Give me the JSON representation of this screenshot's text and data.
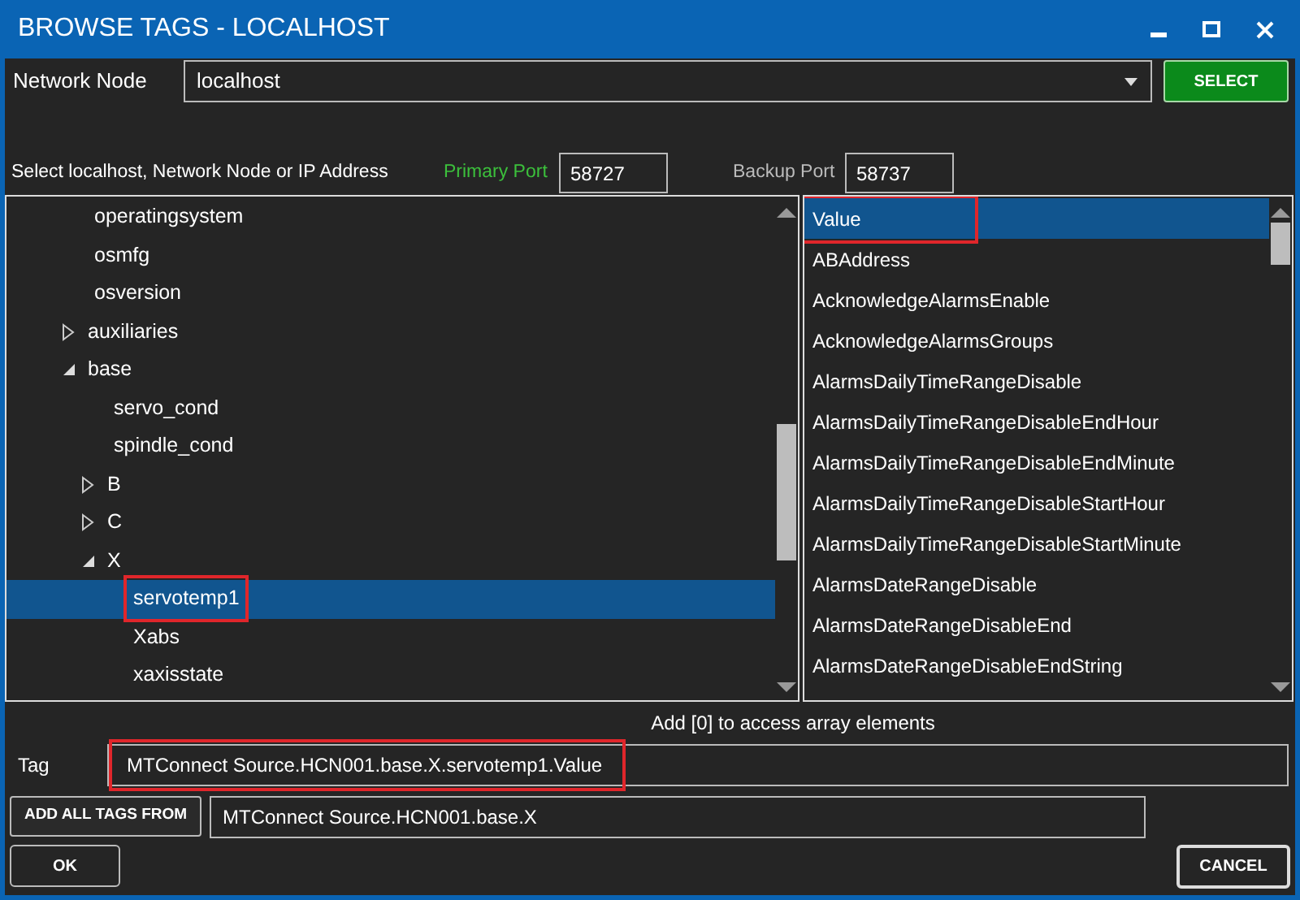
{
  "window": {
    "title": "BROWSE TAGS - LOCALHOST"
  },
  "network_node": {
    "label": "Network Node",
    "value": "localhost",
    "button": "SELECT"
  },
  "hint": "Select localhost, Network Node or IP Address",
  "primary_port": {
    "label": "Primary Port",
    "value": "58727"
  },
  "backup_port": {
    "label": "Backup Port",
    "value": "58737"
  },
  "tree": [
    {
      "label": "operatingsystem",
      "selected": false
    },
    {
      "label": "osmfg",
      "selected": false
    },
    {
      "label": "osversion",
      "selected": false
    },
    {
      "label": "auxiliaries",
      "selected": false,
      "expanded": false
    },
    {
      "label": "base",
      "selected": false,
      "expanded": true,
      "children": [
        {
          "label": "servo_cond",
          "selected": false
        },
        {
          "label": "spindle_cond",
          "selected": false
        },
        {
          "label": "B",
          "selected": false,
          "expanded": false
        },
        {
          "label": "C",
          "selected": false,
          "expanded": false
        },
        {
          "label": "X",
          "selected": false,
          "expanded": true,
          "children": [
            {
              "label": "servotemp1",
              "selected": true,
              "highlighted": true
            },
            {
              "label": "Xabs",
              "selected": false
            },
            {
              "label": "xaxisstate",
              "selected": false
            }
          ]
        }
      ]
    }
  ],
  "properties": [
    {
      "label": "Value",
      "selected": true,
      "highlighted": true
    },
    {
      "label": "ABAddress",
      "selected": false
    },
    {
      "label": "AcknowledgeAlarmsEnable",
      "selected": false
    },
    {
      "label": "AcknowledgeAlarmsGroups",
      "selected": false
    },
    {
      "label": "AlarmsDailyTimeRangeDisable",
      "selected": false
    },
    {
      "label": "AlarmsDailyTimeRangeDisableEndHour",
      "selected": false
    },
    {
      "label": "AlarmsDailyTimeRangeDisableEndMinute",
      "selected": false
    },
    {
      "label": "AlarmsDailyTimeRangeDisableStartHour",
      "selected": false
    },
    {
      "label": "AlarmsDailyTimeRangeDisableStartMinute",
      "selected": false
    },
    {
      "label": "AlarmsDateRangeDisable",
      "selected": false
    },
    {
      "label": "AlarmsDateRangeDisableEnd",
      "selected": false
    },
    {
      "label": "AlarmsDateRangeDisableEndString",
      "selected": false
    }
  ],
  "array_hint": "Add [0] to access array elements",
  "tag": {
    "label": "Tag",
    "value": "MTConnect Source.HCN001.base.X.servotemp1.Value",
    "highlighted": true
  },
  "add_all": {
    "button": "ADD ALL TAGS FROM",
    "value": "MTConnect Source.HCN001.base.X"
  },
  "buttons": {
    "ok": "OK",
    "cancel": "CANCEL"
  }
}
